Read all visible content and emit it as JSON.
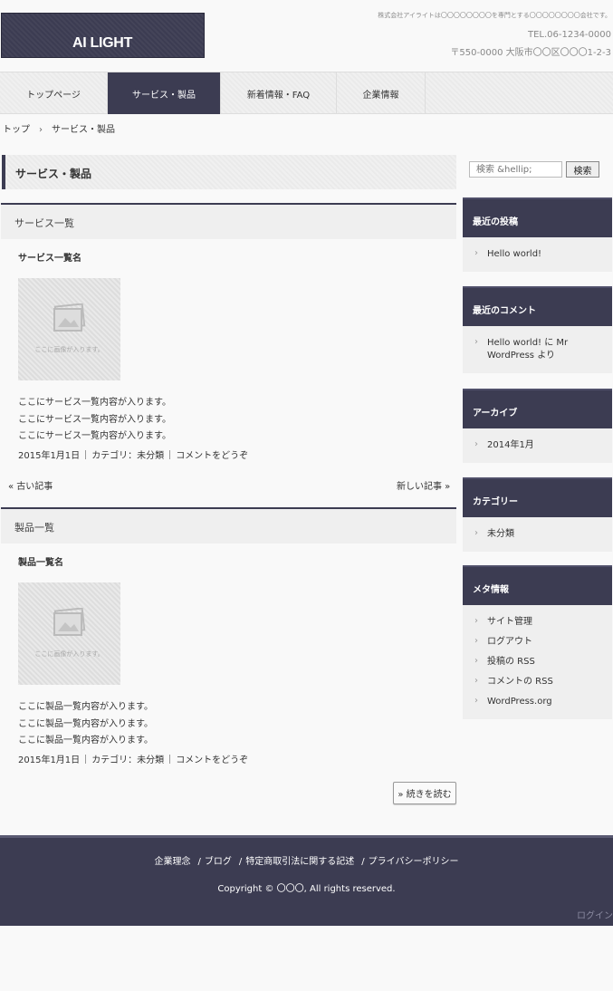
{
  "header": {
    "logo_text": "AI LIGHT",
    "tagline": "株式会社アイライトは〇〇〇〇〇〇〇〇を専門とする〇〇〇〇〇〇〇〇会社です。",
    "tel": "TEL.06-1234-0000",
    "address": "〒550-0000 大阪市〇〇区〇〇〇1-2-3"
  },
  "nav": {
    "items": [
      {
        "label": "トップページ"
      },
      {
        "label": "サービス・製品"
      },
      {
        "label": "新着情報・FAQ"
      },
      {
        "label": "企業情報"
      }
    ]
  },
  "breadcrumb": {
    "home": "トップ",
    "separator": "›",
    "current": "サービス・製品"
  },
  "main": {
    "page_title": "サービス・製品",
    "sections": [
      {
        "heading": "サービス一覧",
        "post_title": "サービス一覧名",
        "image_caption": "ここに画像が入ります。",
        "lines": [
          "ここにサービス一覧内容が入ります。",
          "ここにサービス一覧内容が入ります。",
          "ここにサービス一覧内容が入ります。"
        ],
        "date": "2015年1月1日",
        "category": "カテゴリ：未分類",
        "comment": "コメントをどうぞ"
      },
      {
        "heading": "製品一覧",
        "post_title": "製品一覧名",
        "image_caption": "ここに画像が入ります。",
        "lines": [
          "ここに製品一覧内容が入ります。",
          "ここに製品一覧内容が入ります。",
          "ここに製品一覧内容が入ります。"
        ],
        "date": "2015年1月1日",
        "category": "カテゴリ：未分類",
        "comment": "コメントをどうぞ"
      }
    ],
    "pager": {
      "older": "« 古い記事",
      "newer": "新しい記事 »"
    },
    "read_more": "» 続きを読む"
  },
  "sidebar": {
    "search": {
      "placeholder": "検索 &hellip;",
      "button": "検索"
    },
    "recent_posts": {
      "title": "最近の投稿",
      "items": [
        "Hello world!"
      ]
    },
    "recent_comments": {
      "title": "最近のコメント",
      "items": [
        "Hello world! に Mr WordPress より"
      ]
    },
    "archives": {
      "title": "アーカイブ",
      "items": [
        "2014年1月"
      ]
    },
    "categories": {
      "title": "カテゴリー",
      "items": [
        "未分類"
      ]
    },
    "meta": {
      "title": "メタ情報",
      "items": [
        "サイト管理",
        "ログアウト",
        "投稿の RSS",
        "コメントの RSS",
        "WordPress.org"
      ]
    }
  },
  "footer": {
    "links": [
      "企業理念",
      "ブログ",
      "特定商取引法に関する記述",
      "プライバシーポリシー"
    ],
    "link_separator": "/",
    "copyright": "Copyright © 〇〇〇, All rights reserved.",
    "login": "ログイン"
  },
  "colors": {
    "brand_dark": "#3c3c52",
    "background": "#f9f9f9",
    "panel": "#efefef"
  }
}
